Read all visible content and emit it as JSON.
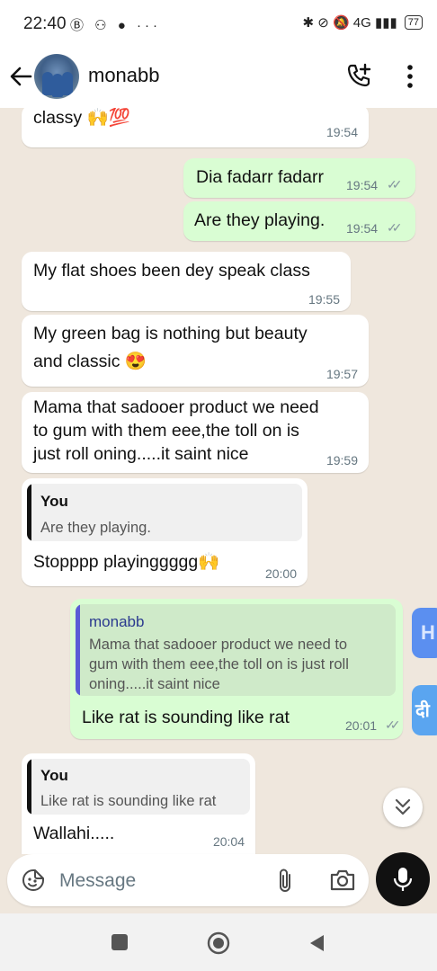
{
  "status_bar": {
    "time": "22:40",
    "left_icons": "Ⓑ ⚇ ●  ···",
    "right_icons": "✱ ⊘ 🔕 4G ▮▮▮",
    "battery": "77"
  },
  "header": {
    "contact_name": "monabb",
    "icons": [
      "back-arrow-icon",
      "avatar",
      "add-call-icon",
      "menu-icon"
    ]
  },
  "messages": [
    {
      "dir": "in",
      "text": "classy 🙌💯",
      "time": "19:54"
    },
    {
      "dir": "out",
      "text": "Dia fadarr fadarr",
      "time": "19:54",
      "ticks": "✓✓"
    },
    {
      "dir": "out",
      "text": "Are they playing.",
      "time": "19:54",
      "ticks": "✓✓"
    },
    {
      "dir": "in",
      "text": "My flat shoes been dey speak class",
      "time": "19:55"
    },
    {
      "dir": "in",
      "lines": [
        "My green bag is nothing but beauty",
        "and classic 😍"
      ],
      "time": "19:57"
    },
    {
      "dir": "in",
      "lines": [
        "Mama that sadooer product we need",
        "to gum with them eee,the toll on is",
        "just roll oning.....it saint nice"
      ],
      "time": "19:59"
    },
    {
      "dir": "in",
      "quote_author": "You",
      "quote_text": "Are they playing.",
      "text": "Stopppp playinggggg🙌",
      "time": "20:00"
    },
    {
      "dir": "out",
      "quote_author": "monabb",
      "quote_lines": [
        "Mama that sadooer product we need to",
        "gum with them eee,the toll on is just roll",
        "oning.....it saint nice"
      ],
      "text": "Like rat is sounding like rat",
      "time": "20:01",
      "ticks": "✓✓"
    },
    {
      "dir": "in",
      "quote_author": "You",
      "quote_text": "Like rat is sounding like rat",
      "text": "Wallahi.....",
      "time": "20:04"
    }
  ],
  "side_chips": [
    "H",
    "दी"
  ],
  "composer": {
    "placeholder": "Message",
    "icons": [
      "emoji-sticker-icon",
      "attach-icon",
      "camera-icon",
      "mic-icon"
    ]
  },
  "colors": {
    "chat_bg": "#efe7dd",
    "incoming": "#ffffff",
    "outgoing": "#d9fdd3",
    "quote_purple": "#5b5bd6"
  }
}
